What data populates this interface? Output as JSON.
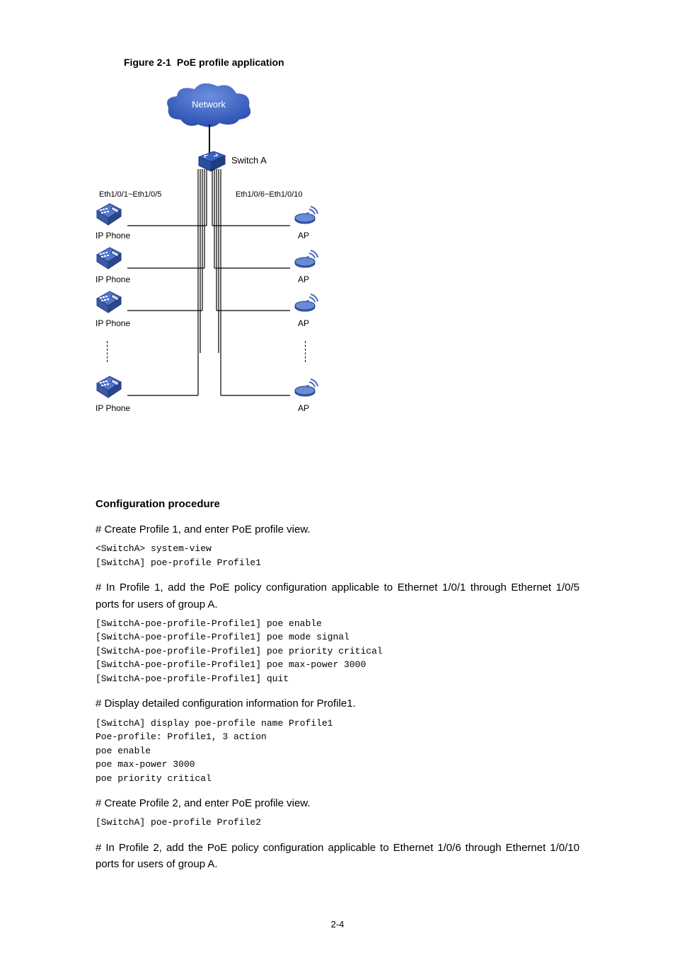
{
  "figure": {
    "label": "Figure 2-1",
    "caption": "PoE profile application",
    "cloud_label": "Network",
    "switch_label": "Switch A",
    "ports_left": "Eth1/0/1~Eth1/0/5",
    "ports_right": "Eth1/0/6~Eth1/0/10",
    "left_device_label": "IP Phone",
    "right_device_label": "AP"
  },
  "proc": {
    "heading": "Configuration procedure",
    "step1": {
      "desc": "# Create Profile 1, and enter PoE profile view.",
      "cli": "<SwitchA> system-view\n[SwitchA] poe-profile Profile1"
    },
    "step2": {
      "desc": "# In Profile 1, add the PoE policy configuration applicable to Ethernet 1/0/1 through Ethernet 1/0/5 ports for users of group A.",
      "cli": "[SwitchA-poe-profile-Profile1] poe enable\n[SwitchA-poe-profile-Profile1] poe mode signal\n[SwitchA-poe-profile-Profile1] poe priority critical\n[SwitchA-poe-profile-Profile1] poe max-power 3000\n[SwitchA-poe-profile-Profile1] quit"
    },
    "step3": {
      "desc": "# Display detailed configuration information for Profile1.",
      "cli": "[SwitchA] display poe-profile name Profile1\nPoe-profile: Profile1, 3 action\npoe enable\npoe max-power 3000\npoe priority critical"
    },
    "step4": {
      "desc": "# Create Profile 2, and enter PoE profile view.",
      "cli": "[SwitchA] poe-profile Profile2"
    },
    "step5": {
      "desc": "# In Profile 2, add the PoE policy configuration applicable to Ethernet 1/0/6 through Ethernet 1/0/10 ports for users of group A."
    }
  },
  "page_number": "2-4"
}
